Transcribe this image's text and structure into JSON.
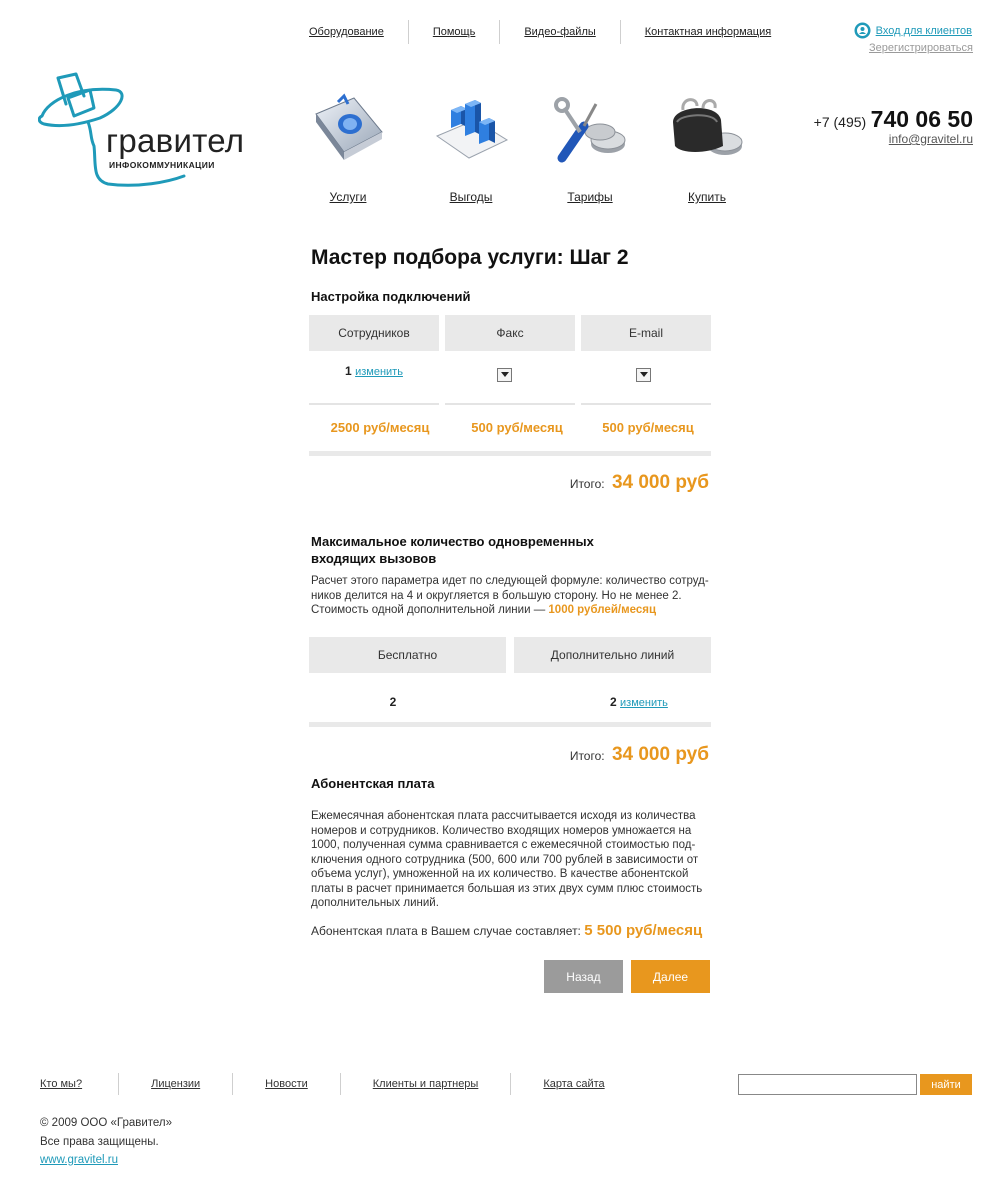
{
  "top_nav": [
    "Оборудование",
    "Помощь",
    "Видео-файлы",
    "Контактная информация"
  ],
  "login": {
    "label": "Вход для клиентов",
    "register": "Зерегистрироваться"
  },
  "contact": {
    "phone_prefix": "+7 (495)",
    "phone_number": "740 06 50",
    "email": "info@gravitel.ru"
  },
  "logo": {
    "name": "гравител",
    "tagline": "ИНФОКОММУНИКАЦИИ"
  },
  "services": [
    {
      "label": "Услуги",
      "icon": "book-icon"
    },
    {
      "label": "Выгоды",
      "icon": "chart-icon"
    },
    {
      "label": "Тарифы",
      "icon": "tools-coins-icon"
    },
    {
      "label": "Купить",
      "icon": "wallet-icon"
    }
  ],
  "page_title": "Мастер подбора услуги: Шаг 2",
  "connections": {
    "title": "Настройка подключений",
    "columns": [
      "Сотрудников",
      "Факс",
      "E-mail"
    ],
    "employees_count": "1",
    "change_label": "изменить",
    "prices": [
      "2500 руб/месяц",
      "500 руб/месяц",
      "500 руб/месяц"
    ],
    "total_label": "Итого:",
    "total_value": "34 000 руб"
  },
  "lines": {
    "title_line1": "Максимальное количество одновременных",
    "title_line2": "входящих вызовов",
    "desc_l1": "Расчет этого параметра идет по следующей формуле: количество сотруд-",
    "desc_l2": "ников делится на 4 и округляется в большую сторону. Но не менее 2.",
    "desc_l3": "Стоимость одной дополнительной линии —",
    "desc_price": "1000 рублей/месяц",
    "columns": [
      "Бесплатно",
      "Дополнительно линий"
    ],
    "free_value": "2",
    "extra_value": "2",
    "change_label": "изменить",
    "total_label": "Итого:",
    "total_value": "34 000 руб"
  },
  "fee": {
    "title": "Абонентская плата",
    "lines": [
      "Ежемесячная абонентская плата рассчитывается исходя из  количества",
      "номеров и сотрудников.  Количество входящих номеров умножается на",
      "1000, полученная сумма сравнивается с ежемесячной  стоимостью под-",
      "ключения одного сотрудника (500, 600 или 700 рублей в зависимости от",
      "объема услуг), умноженной на их количество.  В качестве абонентской",
      "платы в расчет принимается большая из этих двух сумм плюс стоимость",
      "дополнительных линий."
    ],
    "result_label": "Абонентская плата в Вашем случае  составляет:",
    "result_value": "5 500 руб/месяц"
  },
  "buttons": {
    "back": "Назад",
    "next": "Далее"
  },
  "footer": {
    "nav": [
      "Кто мы?",
      "Лицензии",
      "Новости",
      "Клиенты и партнеры",
      "Карта сайта"
    ],
    "search_button": "найти",
    "copyright": "© 2009 ООО «Гравител»",
    "rights": "Все права защищены.",
    "site": "www.gravitel.ru"
  },
  "colors": {
    "accent_orange": "#e8971e",
    "accent_blue": "#1f9ab9",
    "cell_gray": "#e9e9e9",
    "button_gray": "#9b9b9b"
  }
}
